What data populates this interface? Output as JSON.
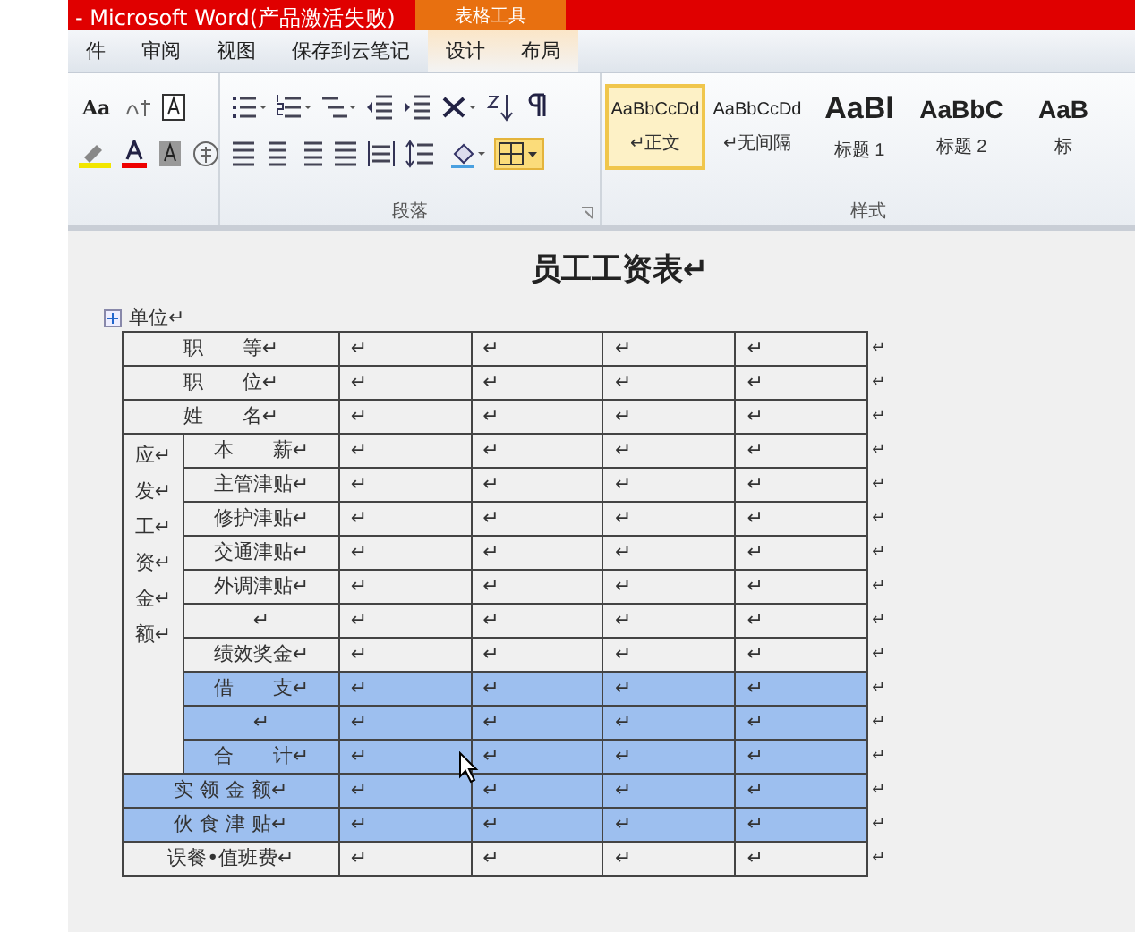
{
  "title_bar": {
    "title": "- Microsoft Word(产品激活失败)",
    "context_group": "表格工具"
  },
  "tabs": [
    {
      "label": "件",
      "selected": false,
      "contextual": false
    },
    {
      "label": "审阅",
      "selected": false,
      "contextual": false
    },
    {
      "label": "视图",
      "selected": false,
      "contextual": false
    },
    {
      "label": "保存到云笔记",
      "selected": false,
      "contextual": false
    },
    {
      "label": "设计",
      "selected": false,
      "contextual": true
    },
    {
      "label": "布局",
      "selected": false,
      "contextual": true
    }
  ],
  "ribbon": {
    "case_button": "Aa",
    "borders_button": {
      "on": true
    },
    "paragraph_label": "段落",
    "styles_label": "样式",
    "styles": [
      {
        "sample": "AaBbCcDd",
        "name": "↵正文",
        "kind": "body",
        "selected": true
      },
      {
        "sample": "AaBbCcDd",
        "name": "↵无间隔",
        "kind": "body",
        "selected": false
      },
      {
        "sample": "AaBl",
        "name": "标题 1",
        "kind": "heading1",
        "selected": false
      },
      {
        "sample": "AaBbC",
        "name": "标题 2",
        "kind": "heading2",
        "selected": false
      },
      {
        "sample": "AaB",
        "name": "标",
        "kind": "heading2",
        "selected": false
      }
    ]
  },
  "document": {
    "title": "员工工资表↵",
    "unit_label": "单位↵",
    "group_label": "应↵\n发↵\n工↵\n资↵\n金↵\n额↵",
    "rows": [
      {
        "kind": "full",
        "label": "职　　等↵",
        "cells": [
          "↵",
          "↵",
          "↵",
          "↵"
        ],
        "end_mark": "↵",
        "selected": false
      },
      {
        "kind": "full",
        "label": "职　　位↵",
        "cells": [
          "↵",
          "↵",
          "↵",
          "↵"
        ],
        "end_mark": "↵",
        "selected": false
      },
      {
        "kind": "full",
        "label": "姓　　名↵",
        "cells": [
          "↵",
          "↵",
          "↵",
          "↵"
        ],
        "end_mark": "↵",
        "selected": false
      },
      {
        "kind": "sub",
        "label": "本　　薪↵",
        "cells": [
          "↵",
          "↵",
          "↵",
          "↵"
        ],
        "end_mark": "↵",
        "selected": false
      },
      {
        "kind": "sub",
        "label": "主管津贴↵",
        "cells": [
          "↵",
          "↵",
          "↵",
          "↵"
        ],
        "end_mark": "↵",
        "selected": false
      },
      {
        "kind": "sub",
        "label": "修护津贴↵",
        "cells": [
          "↵",
          "↵",
          "↵",
          "↵"
        ],
        "end_mark": "↵",
        "selected": false
      },
      {
        "kind": "sub",
        "label": "交通津贴↵",
        "cells": [
          "↵",
          "↵",
          "↵",
          "↵"
        ],
        "end_mark": "↵",
        "selected": false
      },
      {
        "kind": "sub",
        "label": "外调津贴↵",
        "cells": [
          "↵",
          "↵",
          "↵",
          "↵"
        ],
        "end_mark": "↵",
        "selected": false
      },
      {
        "kind": "sub",
        "label": "↵",
        "cells": [
          "↵",
          "↵",
          "↵",
          "↵"
        ],
        "end_mark": "↵",
        "selected": false
      },
      {
        "kind": "sub",
        "label": "绩效奖金↵",
        "cells": [
          "↵",
          "↵",
          "↵",
          "↵"
        ],
        "end_mark": "↵",
        "selected": false
      },
      {
        "kind": "sub",
        "label": "借　　支↵",
        "cells": [
          "↵",
          "↵",
          "↵",
          "↵"
        ],
        "end_mark": "↵",
        "selected": true
      },
      {
        "kind": "sub",
        "label": "↵",
        "cells": [
          "↵",
          "↵",
          "↵",
          "↵"
        ],
        "end_mark": "↵",
        "selected": true
      },
      {
        "kind": "sub",
        "label": "合　　计↵",
        "cells": [
          "↵",
          "↵",
          "↵",
          "↵"
        ],
        "end_mark": "↵",
        "selected": true
      },
      {
        "kind": "full",
        "label": "实 领 金 额↵",
        "cells": [
          "↵",
          "↵",
          "↵",
          "↵"
        ],
        "end_mark": "↵",
        "selected": true
      },
      {
        "kind": "full",
        "label": "伙 食 津 贴↵",
        "cells": [
          "↵",
          "↵",
          "↵",
          "↵"
        ],
        "end_mark": "↵",
        "selected": true
      },
      {
        "kind": "full",
        "label": "误餐•值班费↵",
        "cells": [
          "↵",
          "↵",
          "↵",
          "↵"
        ],
        "end_mark": "↵",
        "selected": false
      }
    ]
  }
}
